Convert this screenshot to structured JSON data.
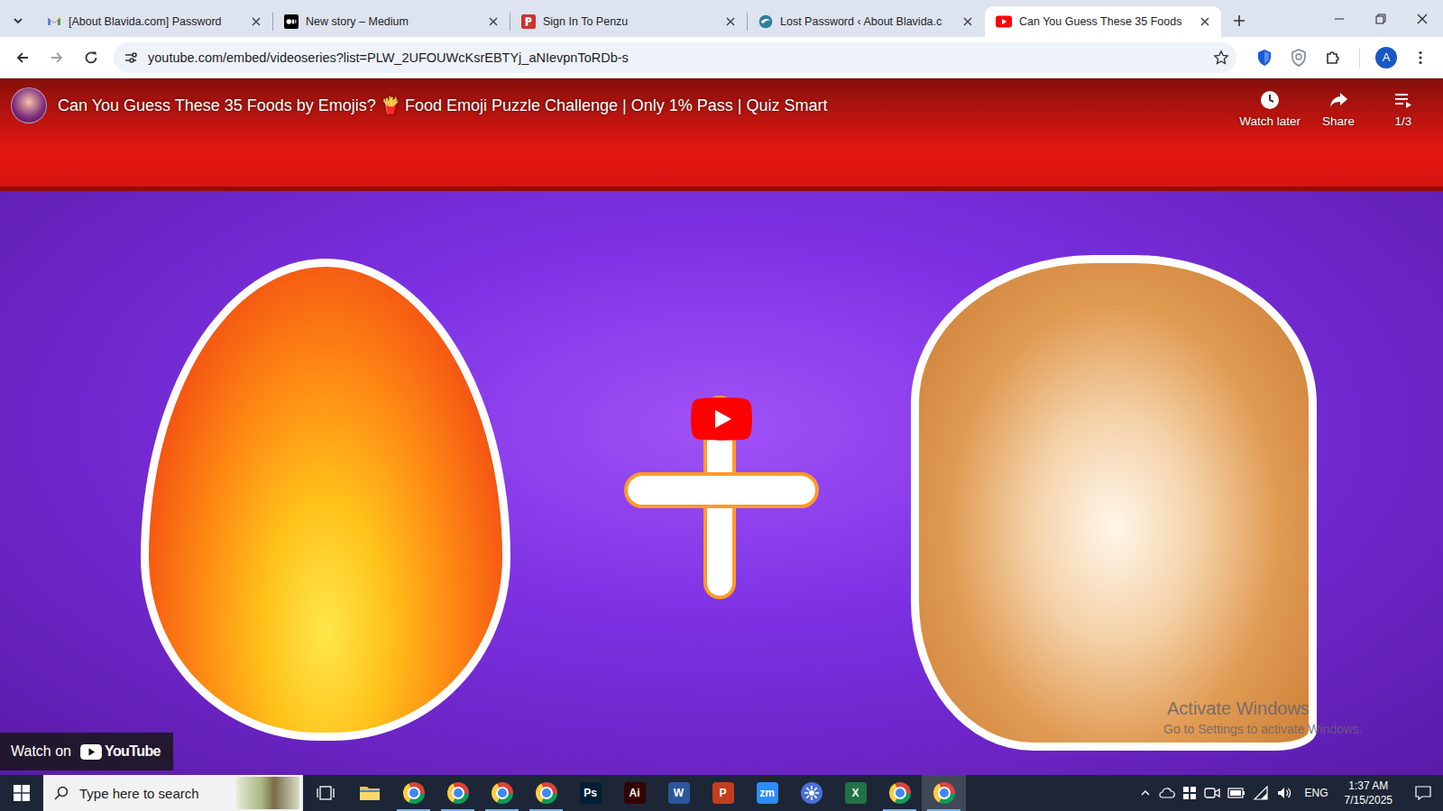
{
  "tabs": [
    {
      "label": "[About Blavida.com] Password",
      "kind": "gmail",
      "selected": false
    },
    {
      "label": "New story – Medium",
      "kind": "medium",
      "selected": false
    },
    {
      "label": "Sign In To Penzu",
      "kind": "penzu",
      "selected": false
    },
    {
      "label": "Lost Password ‹ About Blavida.c",
      "kind": "blavida",
      "selected": false
    },
    {
      "label": "Can You Guess These 35 Foods",
      "kind": "youtube",
      "selected": true
    }
  ],
  "address_bar": {
    "url": "youtube.com/embed/videoseries?list=PLW_2UFOUWcKsrEBTYj_aNIevpnToRDb-s",
    "bookmarked": false
  },
  "profile": {
    "initial": "A"
  },
  "video": {
    "title": "Can You Guess These 35 Foods by Emojis? 🍟 Food Emoji Puzzle Challenge | Only 1% Pass | Quiz Smart",
    "actions": [
      {
        "label": "Watch later",
        "kind": "clock"
      },
      {
        "label": "Share",
        "kind": "share"
      }
    ],
    "playlist_position": "1/3",
    "watch_on": "Watch on",
    "logo": "YouTube"
  },
  "watermark": {
    "title": "Activate Windows",
    "subtitle": "Go to Settings to activate Windows."
  },
  "taskbar": {
    "search_placeholder": "Type here to search",
    "apps": [
      {
        "kind": "explorer",
        "running": false,
        "selected": false
      },
      {
        "kind": "chrome",
        "running": true,
        "selected": false
      },
      {
        "kind": "chrome",
        "running": true,
        "selected": false
      },
      {
        "kind": "chrome",
        "running": true,
        "selected": false
      },
      {
        "kind": "chrome",
        "running": true,
        "selected": false
      },
      {
        "kind": "letter",
        "label": "Ps",
        "color": "#001e36",
        "running": false,
        "selected": false
      },
      {
        "kind": "letter",
        "label": "Ai",
        "color": "#330000",
        "running": false,
        "selected": false
      },
      {
        "kind": "letter",
        "label": "W",
        "color": "#2b579a",
        "running": false,
        "selected": false
      },
      {
        "kind": "letter",
        "label": "P",
        "color": "#c43e1c",
        "running": false,
        "selected": false
      },
      {
        "kind": "letter",
        "label": "zm",
        "color": "#2d8cff",
        "running": false,
        "selected": false
      },
      {
        "kind": "gear",
        "color": "#4a6fd8",
        "running": false,
        "selected": false
      },
      {
        "kind": "letter",
        "label": "X",
        "color": "#217346",
        "running": false,
        "selected": false
      },
      {
        "kind": "chrome",
        "running": true,
        "selected": false
      },
      {
        "kind": "chrome",
        "running": true,
        "selected": true
      }
    ],
    "tray": {
      "language": "ENG",
      "time": "1:37 AM",
      "date": "7/15/2025"
    }
  }
}
